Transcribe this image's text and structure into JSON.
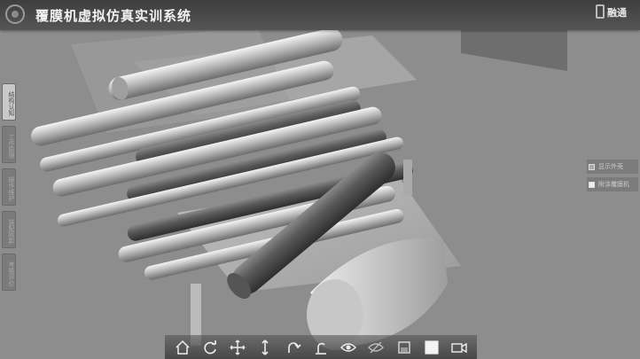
{
  "app": {
    "title": "覆膜机虚拟仿真实训系统",
    "brand": "融通"
  },
  "side_tabs": [
    {
      "label": "结构认知",
      "active": true
    },
    {
      "label": "工作原理",
      "active": false
    },
    {
      "label": "操作维护",
      "active": false
    },
    {
      "label": "装配拆卸",
      "active": false
    },
    {
      "label": "考核评价",
      "active": false
    }
  ],
  "right_panel": {
    "items": [
      {
        "label": "显示外壳",
        "checked": false
      },
      {
        "label": "附涂覆膜机",
        "checked": true
      }
    ]
  },
  "toolbar": {
    "tools": [
      {
        "name": "home-icon"
      },
      {
        "name": "rotate-icon"
      },
      {
        "name": "pan-icon"
      },
      {
        "name": "zoom-vertical-icon"
      },
      {
        "name": "undo-icon"
      },
      {
        "name": "reset-icon"
      },
      {
        "name": "show-icon"
      },
      {
        "name": "hide-icon"
      },
      {
        "name": "window-icon"
      },
      {
        "name": "fullscreen-icon"
      },
      {
        "name": "camera-icon"
      }
    ]
  }
}
